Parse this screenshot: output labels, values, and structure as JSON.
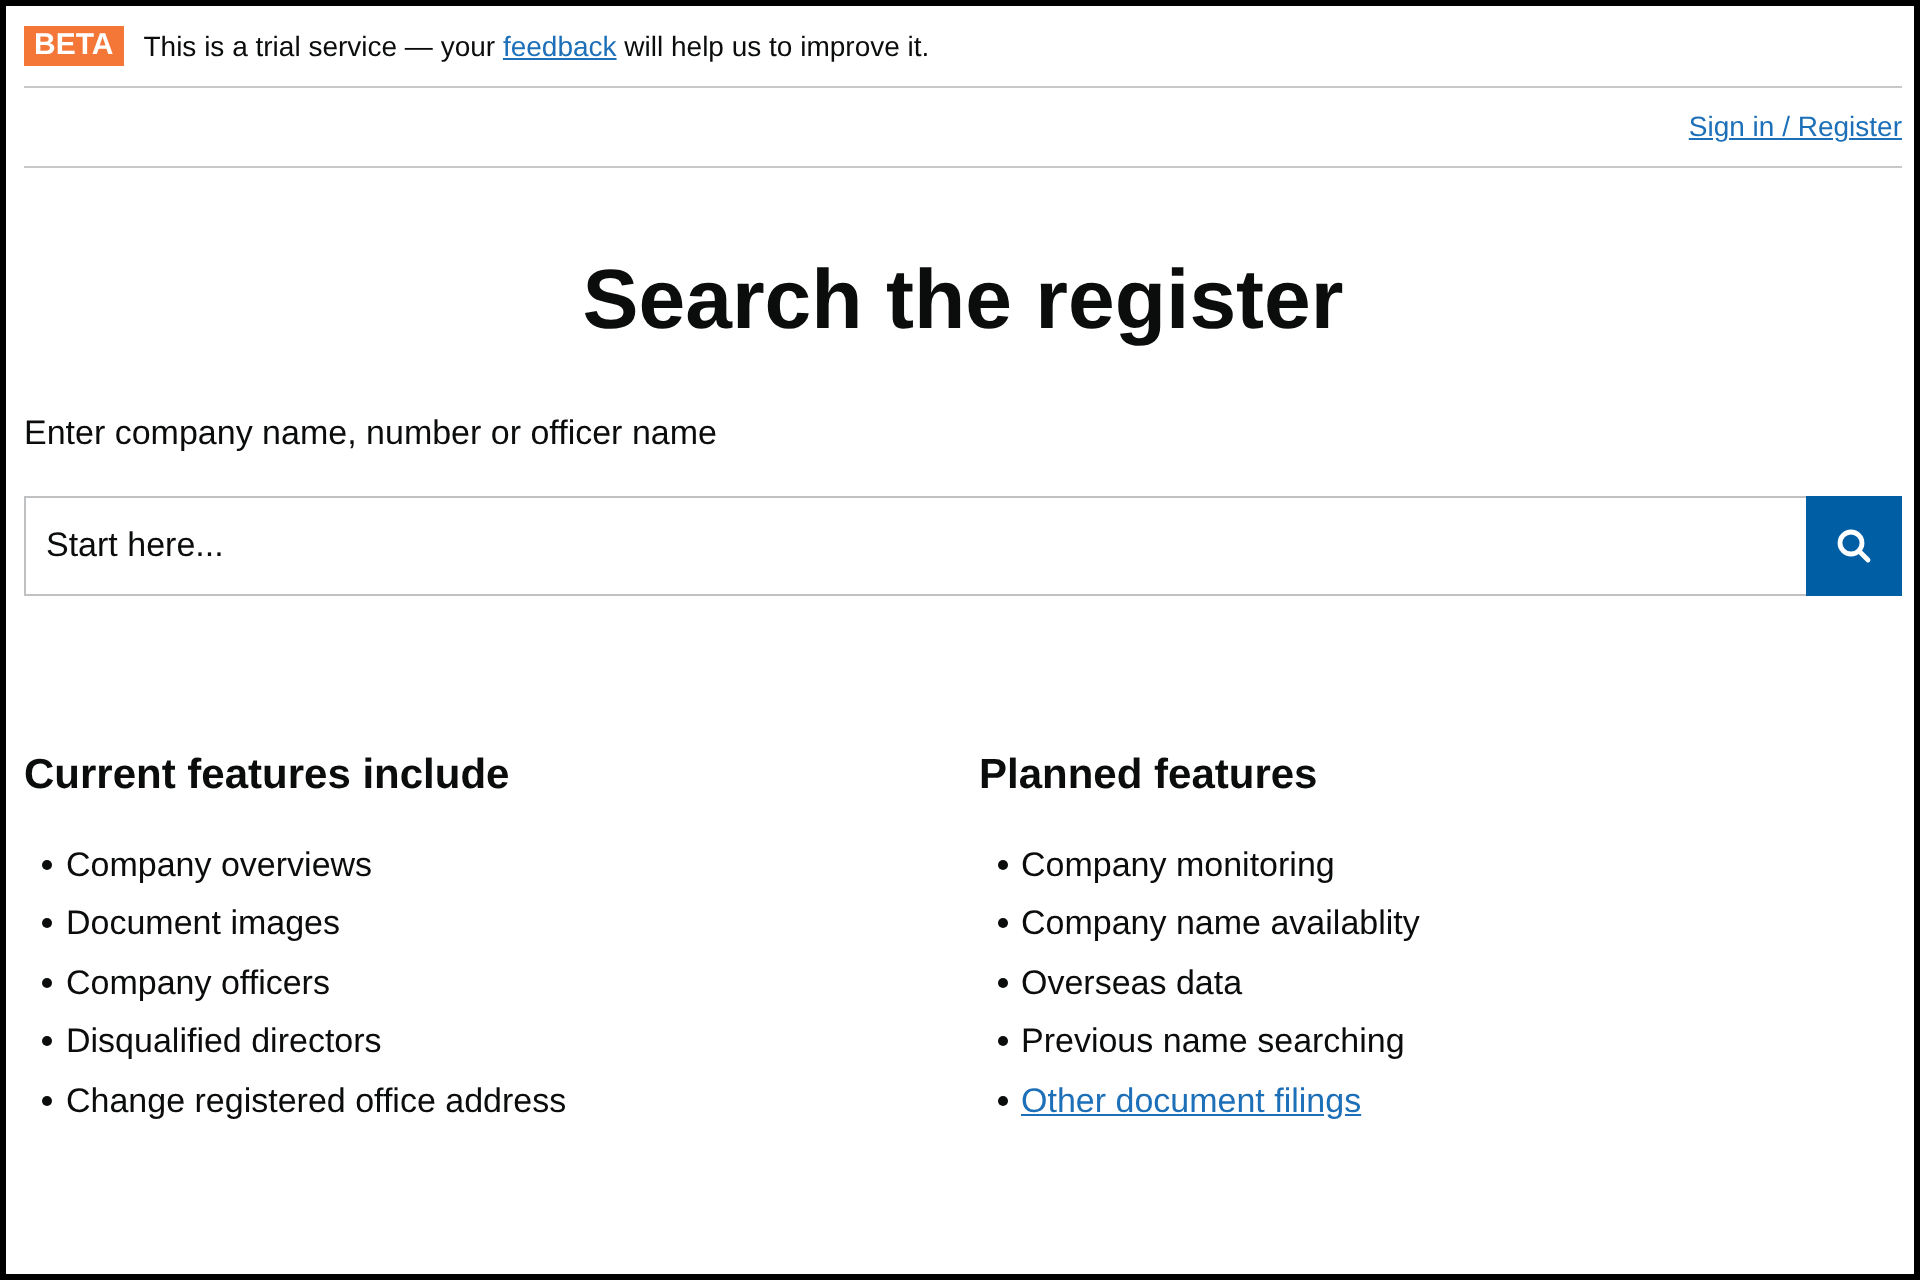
{
  "banner": {
    "badge": "BETA",
    "text_before": "This is a trial service — your",
    "link": "feedback",
    "text_after": "will help us to improve it."
  },
  "header": {
    "sign_in_link": "Sign in / Register"
  },
  "title": "Search the register",
  "search": {
    "label": "Enter company name, number or officer name",
    "placeholder": "Start here..."
  },
  "feature_lists": [
    {
      "heading": "Current features include",
      "items": [
        {
          "kind": "text",
          "text": "Company overviews"
        },
        {
          "kind": "text",
          "text": "Document images"
        },
        {
          "kind": "text",
          "text": "Company officers"
        },
        {
          "kind": "text",
          "text": "Disqualified directors"
        },
        {
          "kind": "text",
          "text": "Change registered office address"
        }
      ]
    },
    {
      "heading": "Planned features",
      "items": [
        {
          "kind": "text",
          "text": "Company monitoring"
        },
        {
          "kind": "text",
          "text": "Company name availablity"
        },
        {
          "kind": "text",
          "text": "Overseas data"
        },
        {
          "kind": "text",
          "text": "Previous name searching"
        },
        {
          "kind": "link",
          "text": "Other document filings"
        }
      ]
    }
  ]
}
